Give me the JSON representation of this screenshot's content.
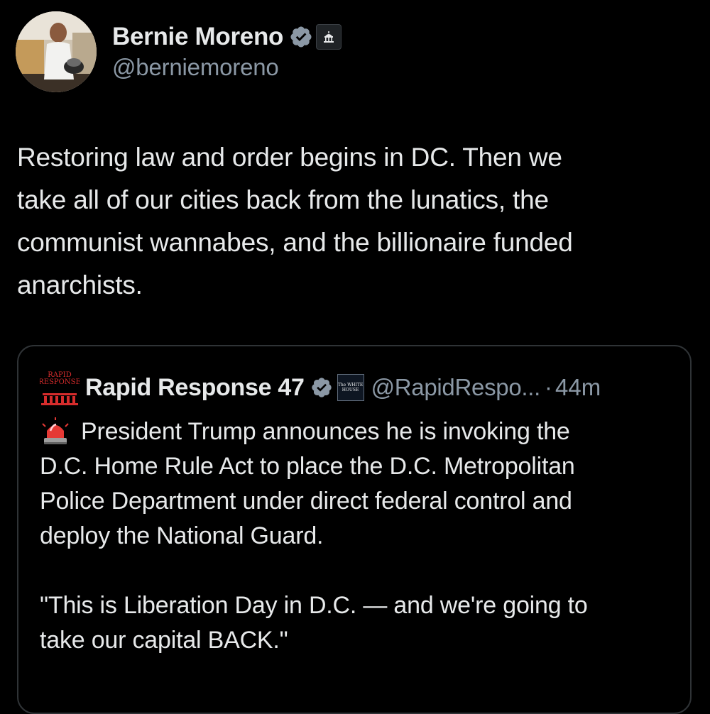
{
  "author": {
    "name": "Bernie Moreno",
    "handle": "@berniemoreno",
    "verified_icon": "verified-badge-icon",
    "affiliation_icon": "government-building-icon"
  },
  "tweet": {
    "text": "Restoring law and order begins in DC. Then we\ntake all of our cities back from the lunatics, the\ncommunist wannabes, and the billionaire funded\nanarchists."
  },
  "quoted": {
    "avatar_text": "RAPID RESPONSE",
    "name": "Rapid Response 47",
    "affiliation_text": "The WHITE HOUSE",
    "handle": "@RapidRespo...",
    "separator": "·",
    "time": "44m",
    "alert_icon": "siren-emoji-icon",
    "first_line": "President Trump announces he is invoking the",
    "rest": "D.C. Home Rule Act to place the D.C. Metropolitan\nPolice Department under direct federal control and\ndeploy the National Guard.\n\n\"This is Liberation Day in D.C. — and we're going to\ntake our capital BACK.\""
  },
  "colors": {
    "background": "#000000",
    "text": "#e7e9ea",
    "secondary": "#8b98a5",
    "verified_blue": "#1d9bf0",
    "border": "#2f3336"
  }
}
